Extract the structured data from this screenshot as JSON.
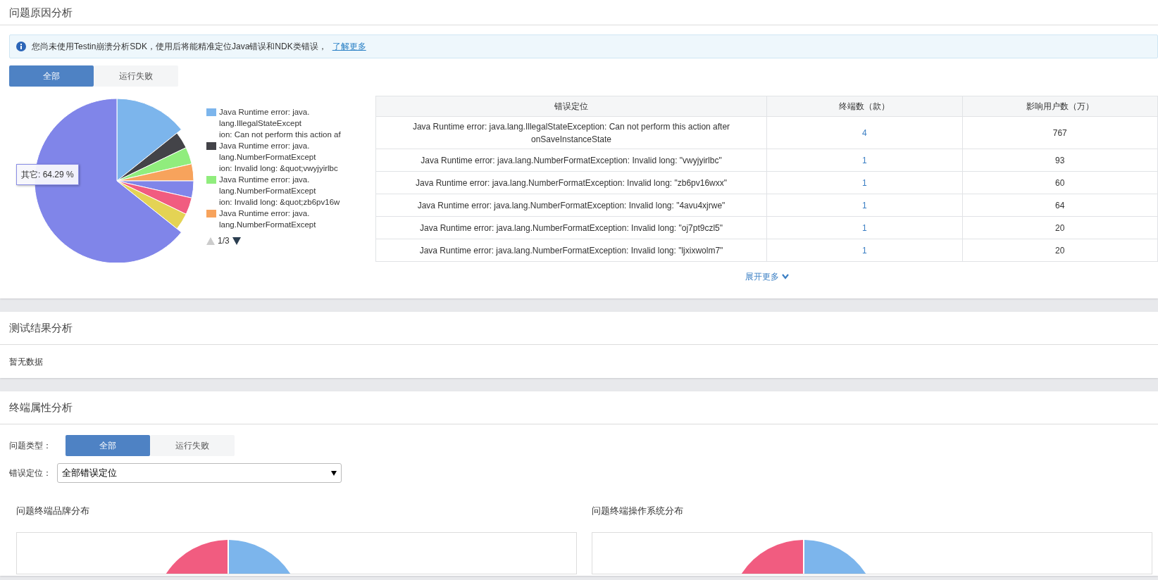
{
  "cause_section": {
    "title": "问题原因分析",
    "notice": {
      "text": "您尚未使用Testin崩溃分析SDK，使用后将能精准定位Java错误和NDK类错误，",
      "link": "了解更多"
    },
    "tabs": [
      {
        "label": "全部",
        "selected": true
      },
      {
        "label": "运行失败",
        "selected": false
      }
    ],
    "pie": {
      "tooltip": "其它: 64.29 %",
      "legend": [
        {
          "color": "#7cb5ec",
          "lines": [
            "Java Runtime error: java.",
            "lang.IllegalStateExcept",
            "ion: Can not perform this action af"
          ]
        },
        {
          "color": "#434348",
          "lines": [
            "Java Runtime error: java.",
            "lang.NumberFormatExcept",
            "ion: Invalid long: &quot;vwyjyirlbc"
          ]
        },
        {
          "color": "#90ed7d",
          "lines": [
            "Java Runtime error: java.",
            "lang.NumberFormatExcept",
            "ion: Invalid long: &quot;zb6pv16w"
          ]
        },
        {
          "color": "#f7a35c",
          "lines": [
            "Java Runtime error: java.",
            "lang.NumberFormatExcept"
          ]
        }
      ],
      "pager": "1/3"
    },
    "table": {
      "columns": [
        "错误定位",
        "终端数（款）",
        "影响用户数（万）"
      ],
      "rows": [
        [
          "Java Runtime error: java.lang.IllegalStateException: Can not perform this action after onSaveInstanceState",
          "4",
          "767"
        ],
        [
          "Java Runtime error: java.lang.NumberFormatException: Invalid long: \"vwyjyirlbc\"",
          "1",
          "93"
        ],
        [
          "Java Runtime error: java.lang.NumberFormatException: Invalid long: \"zb6pv16wxx\"",
          "1",
          "60"
        ],
        [
          "Java Runtime error: java.lang.NumberFormatException: Invalid long: \"4avu4xjrwe\"",
          "1",
          "64"
        ],
        [
          "Java Runtime error: java.lang.NumberFormatException: Invalid long: \"oj7pt9czl5\"",
          "1",
          "20"
        ],
        [
          "Java Runtime error: java.lang.NumberFormatException: Invalid long: \"ljxixwolm7\"",
          "1",
          "20"
        ]
      ]
    },
    "more": "展开更多"
  },
  "result_section": {
    "title": "测试结果分析",
    "empty": "暂无数据"
  },
  "device_section": {
    "title": "终端属性分析",
    "type_label": "问题类型：",
    "type_tabs": [
      {
        "label": "全部",
        "selected": true
      },
      {
        "label": "运行失败",
        "selected": false
      }
    ],
    "location_label": "错误定位：",
    "location_select": "全部错误定位",
    "charts": [
      {
        "title": "问题终端品牌分布"
      },
      {
        "title": "问题终端操作系统分布"
      }
    ]
  }
}
